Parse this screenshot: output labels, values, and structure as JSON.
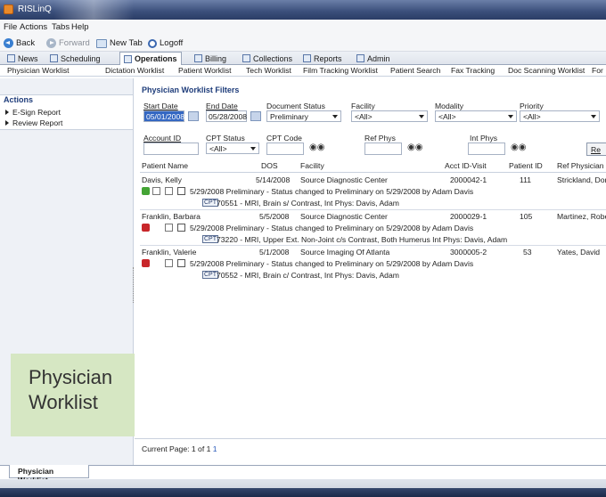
{
  "window": {
    "title": "RISLinQ"
  },
  "menu": [
    "File",
    "Actions",
    "Tabs",
    "Help"
  ],
  "nav": {
    "back": "Back",
    "forward": "Forward",
    "new_tab": "New Tab",
    "logoff": "Logoff"
  },
  "modules": [
    "News",
    "Scheduling",
    "Operations",
    "Billing",
    "Collections",
    "Reports",
    "Admin"
  ],
  "active_module": "Operations",
  "subtabs": [
    "Physician Worklist",
    "Dictation Worklist",
    "Patient Worklist",
    "Tech Worklist",
    "Film Tracking Worklist",
    "Patient Search",
    "Fax Tracking",
    "Doc Scanning Worklist",
    "For"
  ],
  "sidebar": {
    "title": "Actions",
    "items": [
      "E-Sign Report",
      "Review Report"
    ]
  },
  "overlay": {
    "line1": "Physician",
    "line2": "Worklist"
  },
  "filters": {
    "title": "Physician Worklist Filters",
    "start_date_label": "Start Date",
    "start_date": "05/01/2008",
    "end_date_label": "End Date",
    "end_date": "05/28/2008",
    "doc_status_label": "Document Status",
    "doc_status": "Preliminary",
    "facility_label": "Facility",
    "facility": "<All>",
    "modality_label": "Modality",
    "modality": "<All>",
    "priority_label": "Priority",
    "priority": "<All>",
    "account_id_label": "Account ID",
    "cpt_status_label": "CPT Status",
    "cpt_status": "<All>",
    "cpt_code_label": "CPT Code",
    "ref_phys_label": "Ref Phys",
    "int_phys_label": "Int Phys",
    "refresh_label": "Re"
  },
  "columns": {
    "patient_name": "Patient Name",
    "dos": "DOS",
    "facility": "Facility",
    "acct": "Acct ID-Visit",
    "patient_id": "Patient ID",
    "ref_phys": "Ref Physician"
  },
  "patients": [
    {
      "name": "Davis, Kelly",
      "dos": "5/14/2008",
      "facility": "Source Diagnostic Center",
      "acct": "2000042-1",
      "pid": "111",
      "ref": "Strickland, Dor",
      "status_color": "#44a435",
      "status_line": "5/29/2008 Preliminary - Status changed to Preliminary on 5/29/2008 by Adam Davis",
      "cpt": "CPT",
      "detail": "70551 - MRI, Brain s/ Contrast,    Int Phys: Davis, Adam"
    },
    {
      "name": "Franklin, Barbara",
      "dos": "5/5/2008",
      "facility": "Source Diagnostic Center",
      "acct": "2000029-1",
      "pid": "105",
      "ref": "Martinez, Robe",
      "status_color": "#c8262a",
      "status_line": "5/29/2008 Preliminary - Status changed to Preliminary on 5/29/2008 by Adam Davis",
      "cpt": "CPT",
      "detail": "73220 - MRI, Upper Ext. Non-Joint c/s Contrast, Both Humerus  Int Phys: Davis, Adam"
    },
    {
      "name": "Franklin, Valerie",
      "dos": "5/1/2008",
      "facility": "Source Imaging Of Atlanta",
      "acct": "3000005-2",
      "pid": "53",
      "ref": "Yates, David",
      "status_color": "#c8262a",
      "status_line": "5/29/2008 Preliminary - Status changed to Preliminary on 5/29/2008 by Adam Davis",
      "cpt": "CPT",
      "detail": "70552 - MRI, Brain c/ Contrast,    Int Phys: Davis, Adam"
    }
  ],
  "paging": {
    "label": "Current Page: 1 of 1",
    "link": "1"
  },
  "bottom_tab": "Physician Worklist"
}
